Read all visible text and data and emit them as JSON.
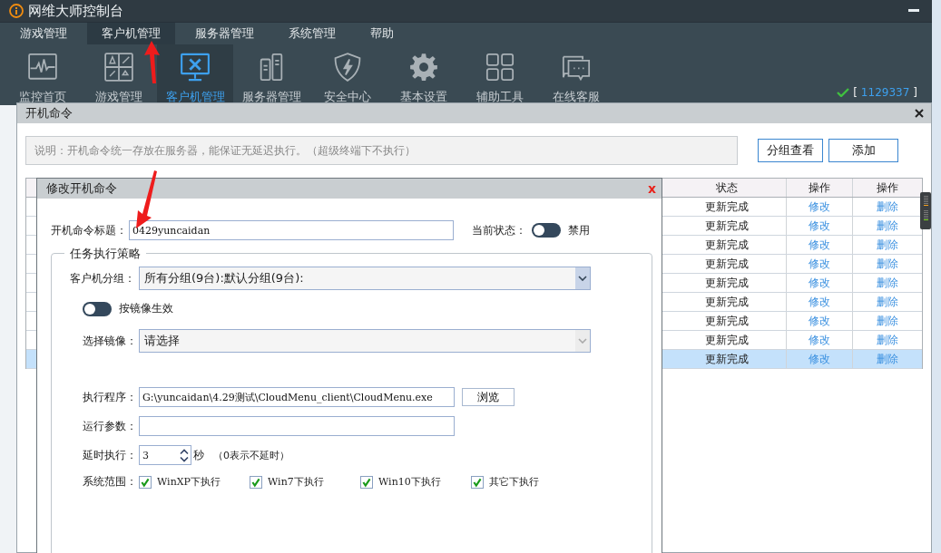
{
  "window": {
    "title": "网维大师控制台"
  },
  "menu": [
    {
      "label": "游戏管理",
      "selected": false
    },
    {
      "label": "客户机管理",
      "selected": true
    },
    {
      "label": "服务器管理",
      "selected": false
    },
    {
      "label": "系统管理",
      "selected": false
    },
    {
      "label": "帮助",
      "selected": false
    }
  ],
  "toolbar": [
    {
      "label": "监控首页",
      "kind": "pulse",
      "selected": false
    },
    {
      "label": "游戏管理",
      "kind": "games",
      "selected": false
    },
    {
      "label": "客户机管理",
      "kind": "tools",
      "selected": true
    },
    {
      "label": "服务器管理",
      "kind": "server",
      "selected": false
    },
    {
      "label": "安全中心",
      "kind": "shield",
      "selected": false
    },
    {
      "label": "基本设置",
      "kind": "gear",
      "selected": false
    },
    {
      "label": "辅助工具",
      "kind": "grid",
      "selected": false
    },
    {
      "label": "在线客服",
      "kind": "chat",
      "selected": false
    }
  ],
  "status": {
    "open": "[",
    "account": "1129337",
    "close": "]"
  },
  "dialog": {
    "title": "开机命令",
    "description": "说明：开机命令统一存放在服务器，能保证无延迟执行。（超级终端下不执行）",
    "buttons": [
      "分组查看",
      "添加"
    ],
    "table": {
      "columns": [
        "状态",
        "操作",
        "操作"
      ],
      "rows": [
        {
          "status": "更新完成",
          "edit": "修改",
          "delete": "删除",
          "selected": false
        },
        {
          "status": "更新完成",
          "edit": "修改",
          "delete": "删除",
          "selected": false
        },
        {
          "status": "更新完成",
          "edit": "修改",
          "delete": "删除",
          "selected": false
        },
        {
          "status": "更新完成",
          "edit": "修改",
          "delete": "删除",
          "selected": false
        },
        {
          "status": "更新完成",
          "edit": "修改",
          "delete": "删除",
          "selected": false
        },
        {
          "status": "更新完成",
          "edit": "修改",
          "delete": "删除",
          "selected": false
        },
        {
          "status": "更新完成",
          "edit": "修改",
          "delete": "删除",
          "selected": false
        },
        {
          "status": "更新完成",
          "edit": "修改",
          "delete": "删除",
          "selected": false
        },
        {
          "status": "更新完成",
          "edit": "修改",
          "delete": "删除",
          "selected": true
        }
      ]
    }
  },
  "edit_dialog": {
    "title": "修改开机命令",
    "close": "x",
    "title_label": "开机命令标题：",
    "title_value": "0429yuncaidan",
    "state_label": "当前状态：",
    "state_on": false,
    "state_text": "禁用",
    "group_title": "任务执行策略",
    "client_group_label": "客户机分组：",
    "client_group_value": "所有分组(9台):默认分组(9台):",
    "image_toggle_on": false,
    "image_toggle_label": "按镜像生效",
    "image_label": "选择镜像：",
    "image_value": "请选择",
    "image_disabled": true,
    "program_label": "执行程序：",
    "program_value": "G:\\yuncaidan\\4.29测试\\CloudMenu_client\\CloudMenu.exe",
    "browse": "浏览",
    "params_label": "运行参数：",
    "delay_label": "延时执行：",
    "delay_value": "3",
    "delay_unit": "秒",
    "delay_hint": "（0表示不延时）",
    "os_label": "系统范围：",
    "os": [
      {
        "label": "WinXP下执行",
        "checked": true
      },
      {
        "label": "Win7下执行",
        "checked": true
      },
      {
        "label": "Win10下执行",
        "checked": true
      },
      {
        "label": "其它下执行",
        "checked": true
      }
    ]
  }
}
